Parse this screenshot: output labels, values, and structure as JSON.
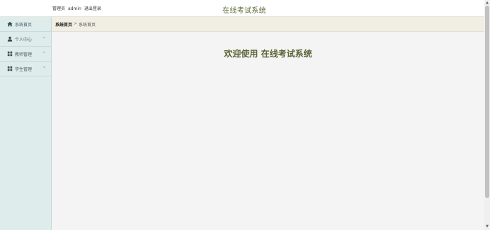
{
  "header": {
    "role_label": "管理员",
    "username": "admin",
    "logout_label": "退出登录",
    "app_title": "在线考试系统"
  },
  "sidebar": {
    "items": [
      {
        "label": "系统首页",
        "icon": "home-icon",
        "has_arrow": false
      },
      {
        "label": "个人中心",
        "icon": "user-icon",
        "has_arrow": true
      },
      {
        "label": "教师管理",
        "icon": "grid-icon",
        "has_arrow": true
      },
      {
        "label": "学生管理",
        "icon": "grid-icon",
        "has_arrow": true
      }
    ]
  },
  "breadcrumb": {
    "home": "系统首页",
    "separator": ">",
    "current": "系统首页"
  },
  "main": {
    "welcome": "欢迎使用 在线考试系统"
  },
  "colors": {
    "sidebar_bg": "#deecec",
    "breadcrumb_bg": "#f1efe4",
    "accent": "#5c6236",
    "title": "#5a6a3a"
  }
}
